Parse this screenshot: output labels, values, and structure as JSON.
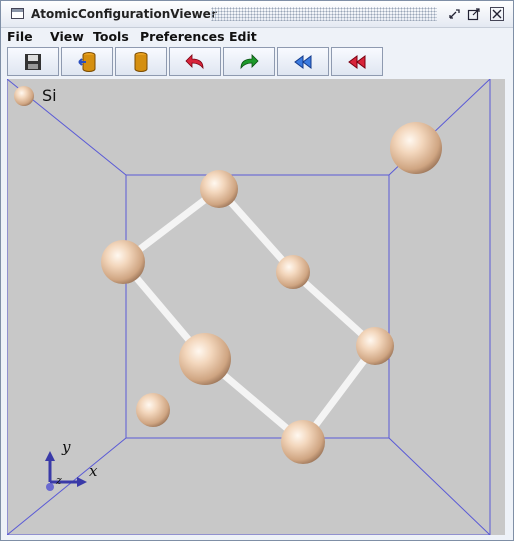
{
  "window": {
    "title": "AtomicConfigurationViewer"
  },
  "menu": [
    "File",
    "View",
    "Tools",
    "Preferences",
    "Edit"
  ],
  "toolbar": [
    {
      "name": "save-icon"
    },
    {
      "name": "load-icon"
    },
    {
      "name": "database-icon"
    },
    {
      "name": "undo-icon"
    },
    {
      "name": "redo-icon"
    },
    {
      "name": "rewind-icon"
    },
    {
      "name": "fast-rewind-icon"
    }
  ],
  "legend": {
    "element": "Si",
    "color": "#f2d4b8"
  },
  "axes": {
    "x_label": "x",
    "y_label": "y",
    "z_label": "z"
  },
  "colors": {
    "box": "#5a5ad6",
    "background": "#c8c8c8",
    "bond": "#ffffff",
    "atom": "#f0cfb2"
  }
}
